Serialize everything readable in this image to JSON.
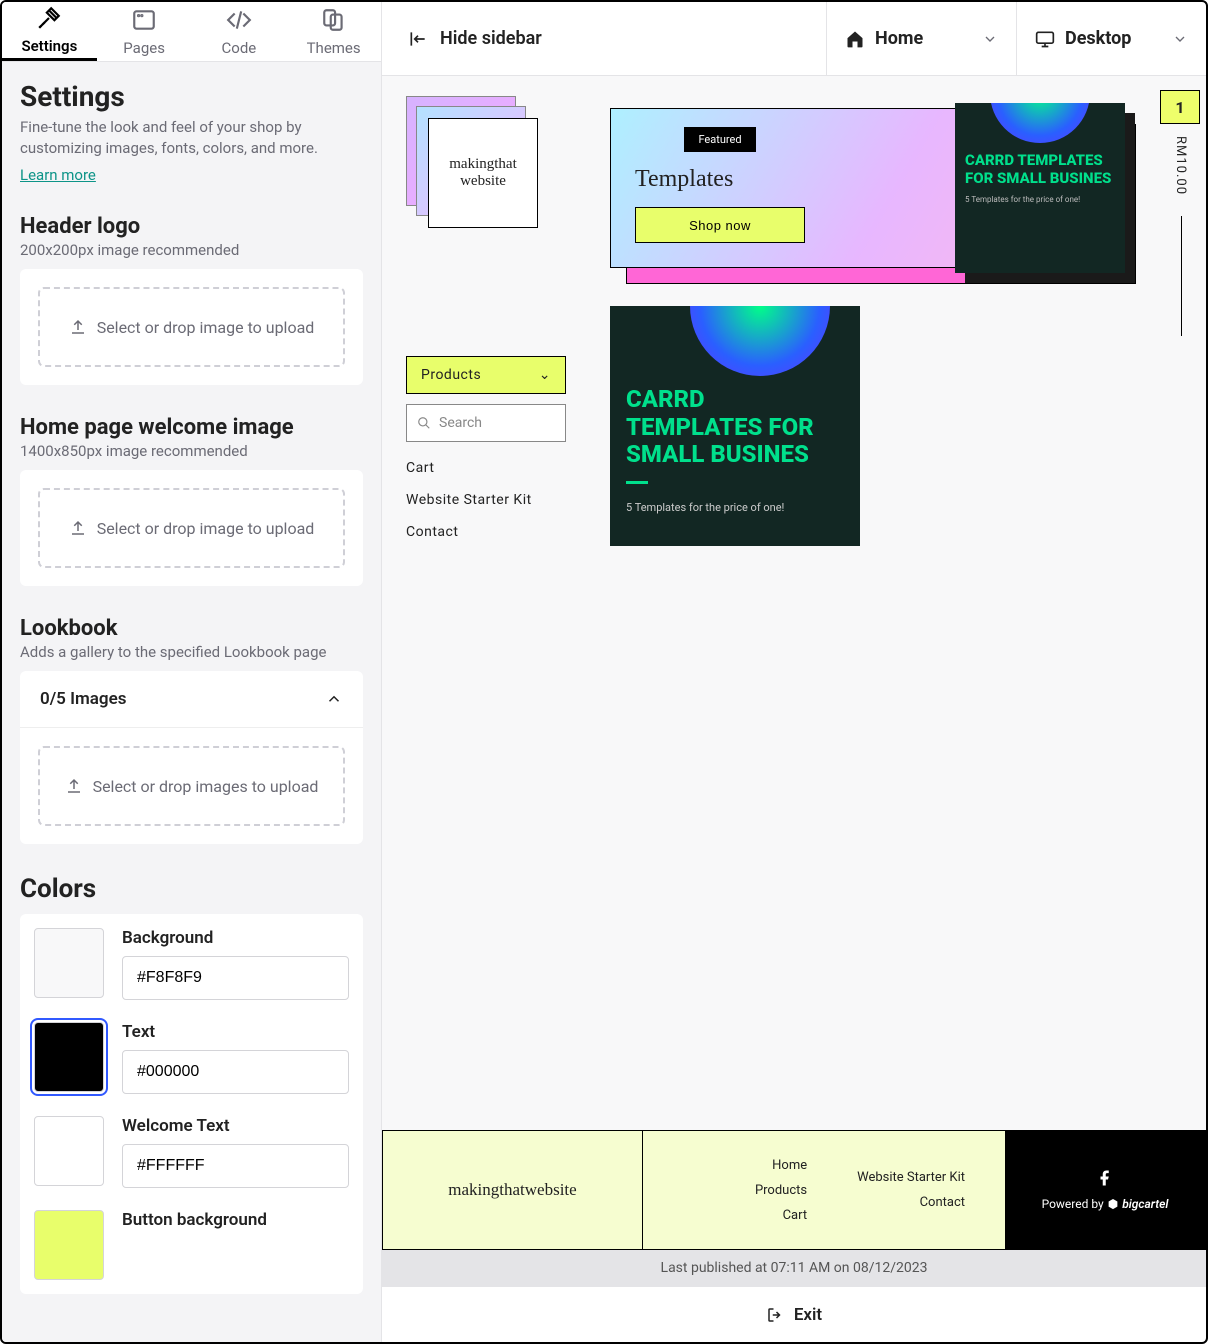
{
  "tabs": {
    "settings": "Settings",
    "pages": "Pages",
    "code": "Code",
    "themes": "Themes"
  },
  "settings_panel": {
    "title": "Settings",
    "description": "Fine-tune the look and feel of your shop by customizing images, fonts, colors, and more.",
    "learn_more": "Learn more",
    "header_logo": {
      "title": "Header logo",
      "hint": "200x200px image recommended",
      "upload": "Select or drop image to upload"
    },
    "welcome_image": {
      "title": "Home page welcome image",
      "hint": "1400x850px image recommended",
      "upload": "Select or drop image to upload"
    },
    "lookbook": {
      "title": "Lookbook",
      "hint": "Adds a gallery to the specified Lookbook page",
      "count": "0/5 Images",
      "upload": "Select or drop images to upload"
    },
    "colors": {
      "title": "Colors",
      "items": [
        {
          "label": "Background",
          "value": "#F8F8F9",
          "swatch": "#F8F8F9"
        },
        {
          "label": "Text",
          "value": "#000000",
          "swatch": "#000000"
        },
        {
          "label": "Welcome Text",
          "value": "#FFFFFF",
          "swatch": "#FFFFFF"
        },
        {
          "label": "Button background",
          "value": "",
          "swatch": "#E8FE6B"
        }
      ]
    }
  },
  "topbar": {
    "hide_sidebar": "Hide sidebar",
    "page": "Home",
    "device": "Desktop"
  },
  "preview": {
    "logo_text": "makingthat\nwebsite",
    "products_btn": "Products",
    "search_placeholder": "Search",
    "nav": [
      "Cart",
      "Website Starter Kit",
      "Contact"
    ],
    "hero": {
      "featured": "Featured",
      "title": "Templates",
      "shop": "Shop now",
      "img_title": "CARRD TEMPLATES FOR SMALL BUSINES",
      "img_sub": "5 Templates for the price of one!"
    },
    "cart_count": "1",
    "price": "RM10.00",
    "tile": {
      "title": "CARRD TEMPLATES FOR SMALL BUSINES",
      "sub": "5 Templates for the price of one!"
    },
    "footer": {
      "logo": "makingthatwebsite",
      "col1": [
        "Home",
        "Products",
        "Cart"
      ],
      "col2": [
        "Website Starter Kit",
        "Contact"
      ],
      "powered": "Powered by",
      "brand": "bigcartel"
    }
  },
  "status": "Last published at 07:11 AM on 08/12/2023",
  "exit": "Exit"
}
